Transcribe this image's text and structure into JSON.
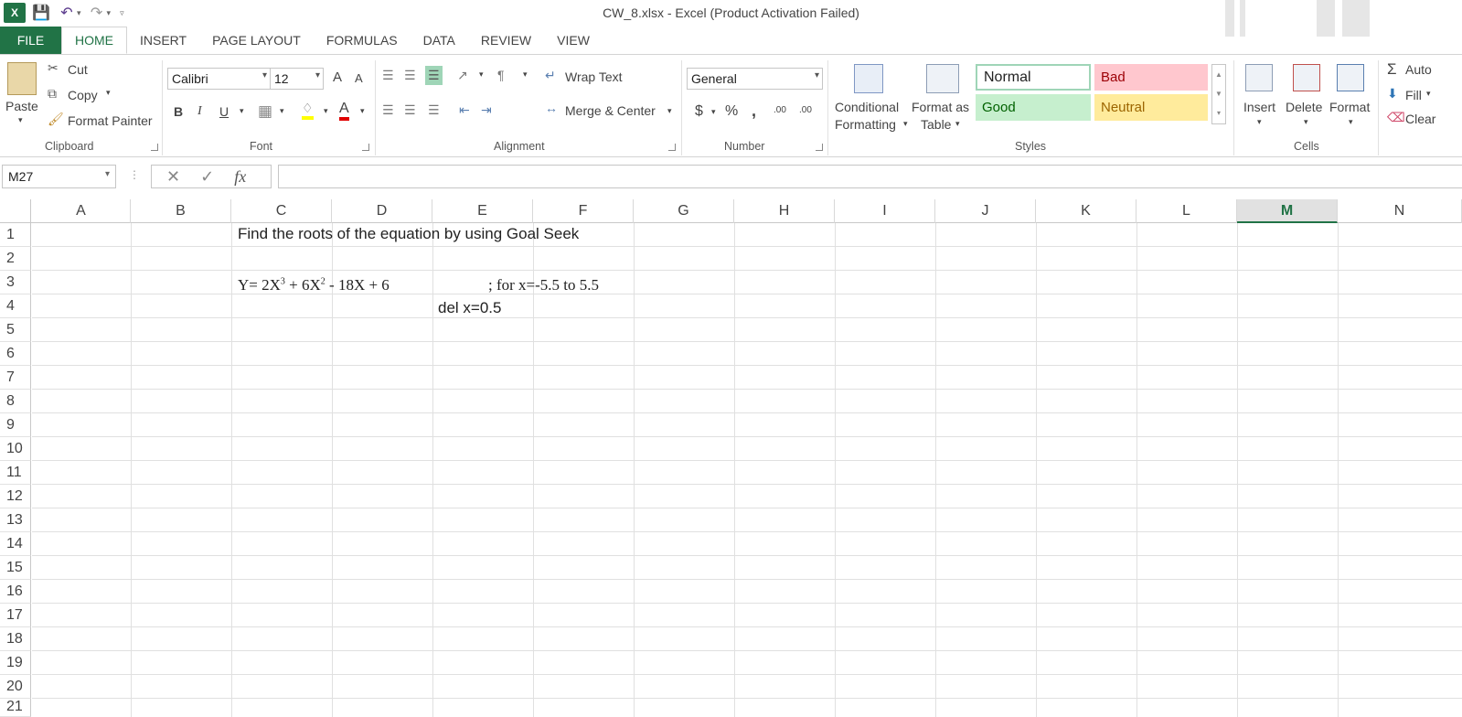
{
  "window": {
    "title": "CW_8.xlsx - Excel (Product Activation Failed)",
    "app_logo": "X"
  },
  "tabs": [
    "FILE",
    "HOME",
    "INSERT",
    "PAGE LAYOUT",
    "FORMULAS",
    "DATA",
    "REVIEW",
    "VIEW"
  ],
  "ribbon": {
    "clipboard": {
      "paste": "Paste",
      "cut": "Cut",
      "copy": "Copy",
      "format_painter": "Format Painter",
      "label": "Clipboard"
    },
    "font": {
      "name": "Calibri",
      "size": "12",
      "grow": "A",
      "shrink": "A",
      "bold": "B",
      "italic": "I",
      "underline": "U",
      "font_color_letter": "A",
      "label": "Font"
    },
    "alignment": {
      "wrap_text": "Wrap Text",
      "merge_center": "Merge & Center",
      "label": "Alignment"
    },
    "number": {
      "format": "General",
      "currency": "$",
      "percent": "%",
      "comma": ",",
      "inc_decimal": ".00",
      "dec_decimal": ".00",
      "label": "Number"
    },
    "styles": {
      "conditional_line1": "Conditional",
      "conditional_line2": "Formatting",
      "format_as_line1": "Format as",
      "format_as_line2": "Table",
      "normal": "Normal",
      "bad": "Bad",
      "good": "Good",
      "neutral": "Neutral",
      "label": "Styles"
    },
    "cells": {
      "insert": "Insert",
      "delete": "Delete",
      "format": "Format",
      "label": "Cells"
    },
    "editing": {
      "autosum": "Auto",
      "fill": "Fill",
      "clear": "Clear"
    }
  },
  "formula_bar": {
    "name_box": "M27",
    "fx": "fx",
    "content": ""
  },
  "columns": [
    "A",
    "B",
    "C",
    "D",
    "E",
    "F",
    "G",
    "H",
    "I",
    "J",
    "K",
    "L",
    "M",
    "N"
  ],
  "selected_column": "M",
  "rows": [
    "1",
    "2",
    "3",
    "4",
    "5",
    "6",
    "7",
    "8",
    "9",
    "10",
    "11",
    "12",
    "13",
    "14",
    "15",
    "16",
    "17",
    "18",
    "19",
    "20",
    "21"
  ],
  "cells": {
    "C1": "Find the roots of the equation by using Goal Seek",
    "C3_prefix": "Y= 2X",
    "C3_exp1": "3",
    "C3_mid": " + 6X",
    "C3_exp2": "2",
    "C3_suffix": " - 18X + 6",
    "E3": "; for x=-5.5 to 5.5",
    "E4": "del x=0.5"
  },
  "colors": {
    "excel_green": "#217346",
    "bad_bg": "#ffc7ce",
    "bad_fg": "#9c0006",
    "good_bg": "#c6efce",
    "good_fg": "#006100",
    "neutral_bg": "#ffeb9c",
    "neutral_fg": "#9c6500"
  }
}
